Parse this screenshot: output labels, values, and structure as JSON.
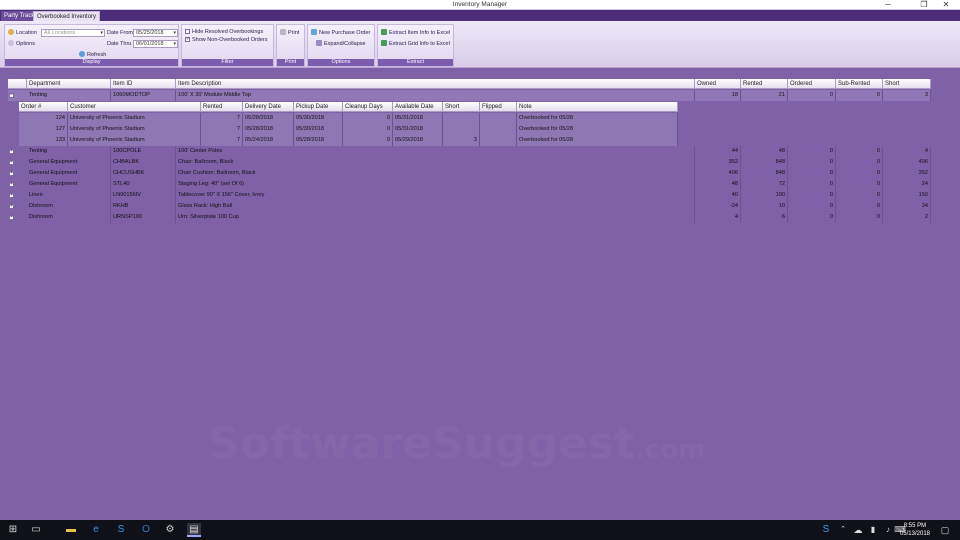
{
  "window": {
    "title": "Inventory Manager",
    "min": "─",
    "max": "❐",
    "close": "✕"
  },
  "tabs": [
    {
      "label": "Party Track"
    },
    {
      "label": "Overbooked Inventory"
    }
  ],
  "ribbon": {
    "display": {
      "title": "Display",
      "location_label": "Location",
      "location_value": "All Locations",
      "options_label": "Options",
      "date_from_label": "Date From",
      "date_from_value": "05/25/2018",
      "date_thru_label": "Date Thru",
      "date_thru_value": "06/01/2018",
      "refresh_label": "Refresh"
    },
    "filter": {
      "title": "Filter",
      "hide_resolved": "Hide Resolved Overbookings",
      "show_non_overbooked": "Show Non-Overbooked Orders"
    },
    "print": {
      "title": "Print",
      "label": "Print"
    },
    "options": {
      "title": "Options",
      "new_po": "New Purchase Order",
      "expand_collapse": "Expand/Collapse"
    },
    "extract": {
      "title": "Extract",
      "item_info": "Extract Item Info to Excel",
      "grid_info": "Extract Grid Info to Excel"
    }
  },
  "grid": {
    "columns": [
      "Department",
      "Item ID",
      "Item Description",
      "Owned",
      "Rented",
      "Ordered",
      "Sub-Rented",
      "Short"
    ],
    "rows": [
      {
        "expander": "−",
        "department": "Tenting",
        "item_id": "1060MODTOP",
        "description": "100' X 30' Module Middle Top",
        "owned": "18",
        "rented": "21",
        "ordered": "0",
        "subrented": "0",
        "short": "3"
      },
      {
        "expander": "+",
        "department": "Tenting",
        "item_id": "100CPOLE",
        "description": "100' Center Poles",
        "owned": "44",
        "rented": "48",
        "ordered": "0",
        "subrented": "0",
        "short": "4"
      },
      {
        "expander": "+",
        "department": "General Equipment",
        "item_id": "CHBALBK",
        "description": "Chair: Ballroom, Black",
        "owned": "352",
        "rented": "848",
        "ordered": "0",
        "subrented": "0",
        "short": "496"
      },
      {
        "expander": "+",
        "department": "General Equipment",
        "item_id": "CHCUSHBK",
        "description": "Chair Cushion: Ballroom, Black",
        "owned": "496",
        "rented": "848",
        "ordered": "0",
        "subrented": "0",
        "short": "352"
      },
      {
        "expander": "+",
        "department": "General Equipment",
        "item_id": "STL40",
        "description": "Staging Leg: 40\" (set Of 6)",
        "owned": "48",
        "rented": "72",
        "ordered": "0",
        "subrented": "0",
        "short": "24"
      },
      {
        "expander": "+",
        "department": "Linen",
        "item_id": "LN90156IV",
        "description": "Tablecover 90\" X 156\" Cover, Ivory",
        "owned": "40",
        "rented": "190",
        "ordered": "0",
        "subrented": "0",
        "short": "150"
      },
      {
        "expander": "+",
        "department": "Dishroom",
        "item_id": "RKHB",
        "description": "Glass Rack: High Ball",
        "owned": "-24",
        "rented": "10",
        "ordered": "0",
        "subrented": "0",
        "short": "34"
      },
      {
        "expander": "+",
        "department": "Dishroom",
        "item_id": "URNSP100",
        "description": "Urn: Silverplate 100 Cup",
        "owned": "4",
        "rented": "6",
        "ordered": "0",
        "subrented": "0",
        "short": "2"
      }
    ]
  },
  "child_grid": {
    "columns": [
      "Order #",
      "Customer",
      "Rented",
      "Delivery Date",
      "Pickup Date",
      "Cleanup Days",
      "Available Date",
      "Short",
      "Flipped",
      "Note"
    ],
    "rows": [
      {
        "order": "124",
        "customer": "University of Phoenix Stadium",
        "rented": "7",
        "delivery": "05/28/2018",
        "pickup": "05/30/2018",
        "cleanup": "0",
        "available": "05/31/2018",
        "short": "",
        "flipped": "",
        "note": "Overbooked for 05/28"
      },
      {
        "order": "127",
        "customer": "University of Phoenix Stadium",
        "rented": "7",
        "delivery": "05/28/2018",
        "pickup": "05/30/2018",
        "cleanup": "0",
        "available": "05/31/2018",
        "short": "",
        "flipped": "",
        "note": "Overbooked for 05/28"
      },
      {
        "order": "133",
        "customer": "University of Phoenix Stadium",
        "rented": "7",
        "delivery": "05/24/2018",
        "pickup": "05/28/2018",
        "cleanup": "0",
        "available": "05/29/2018",
        "short": "3",
        "flipped": "",
        "note": "Overbooked for 05/28"
      }
    ]
  },
  "watermark": {
    "main": "SoftwareSuggest",
    "suffix": ".com"
  },
  "taskbar": {
    "time": "8:55 PM",
    "date": "05/13/2018"
  },
  "colors": {
    "background": "#7e61a6",
    "ribbon_group_title": "#7c5cae",
    "tab_bar": "#4b2e77"
  }
}
